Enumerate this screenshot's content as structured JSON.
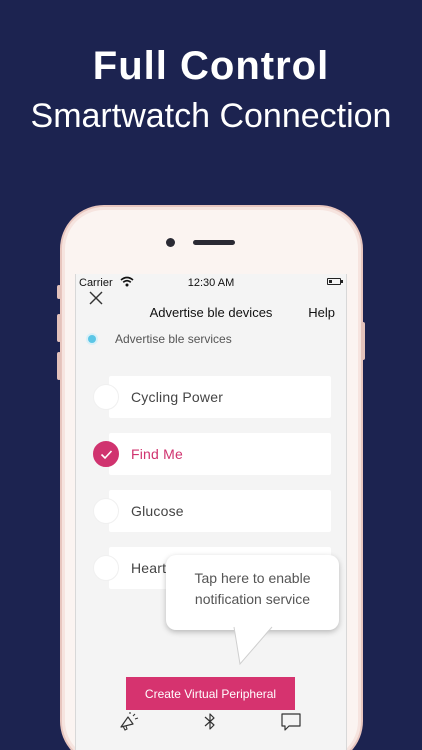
{
  "promo": {
    "headline": "Full Control",
    "subheadline": "Smartwatch Connection"
  },
  "status_bar": {
    "carrier": "Carrier",
    "time": "12:30 AM"
  },
  "nav": {
    "title": "Advertise ble devices",
    "help_label": "Help"
  },
  "advertise_toggle": {
    "label": "Advertise ble services"
  },
  "services": [
    {
      "label": "Cycling Power",
      "selected": false
    },
    {
      "label": "Find Me",
      "selected": true
    },
    {
      "label": "Glucose",
      "selected": false
    },
    {
      "label": "Heart",
      "selected": false
    }
  ],
  "tooltip": {
    "line1": "Tap here to enable",
    "line2": "notification service"
  },
  "create_button_label": "Create Virtual Peripheral",
  "tab_bar": {
    "icons": [
      "megaphone-icon",
      "bluetooth-icon",
      "chat-bubble-icon"
    ]
  },
  "pagination": {
    "count": 3,
    "active_index": 0
  },
  "colors": {
    "background": "#1c2350",
    "accent": "#d6336f",
    "advertise_dot": "#5bc6e6"
  }
}
